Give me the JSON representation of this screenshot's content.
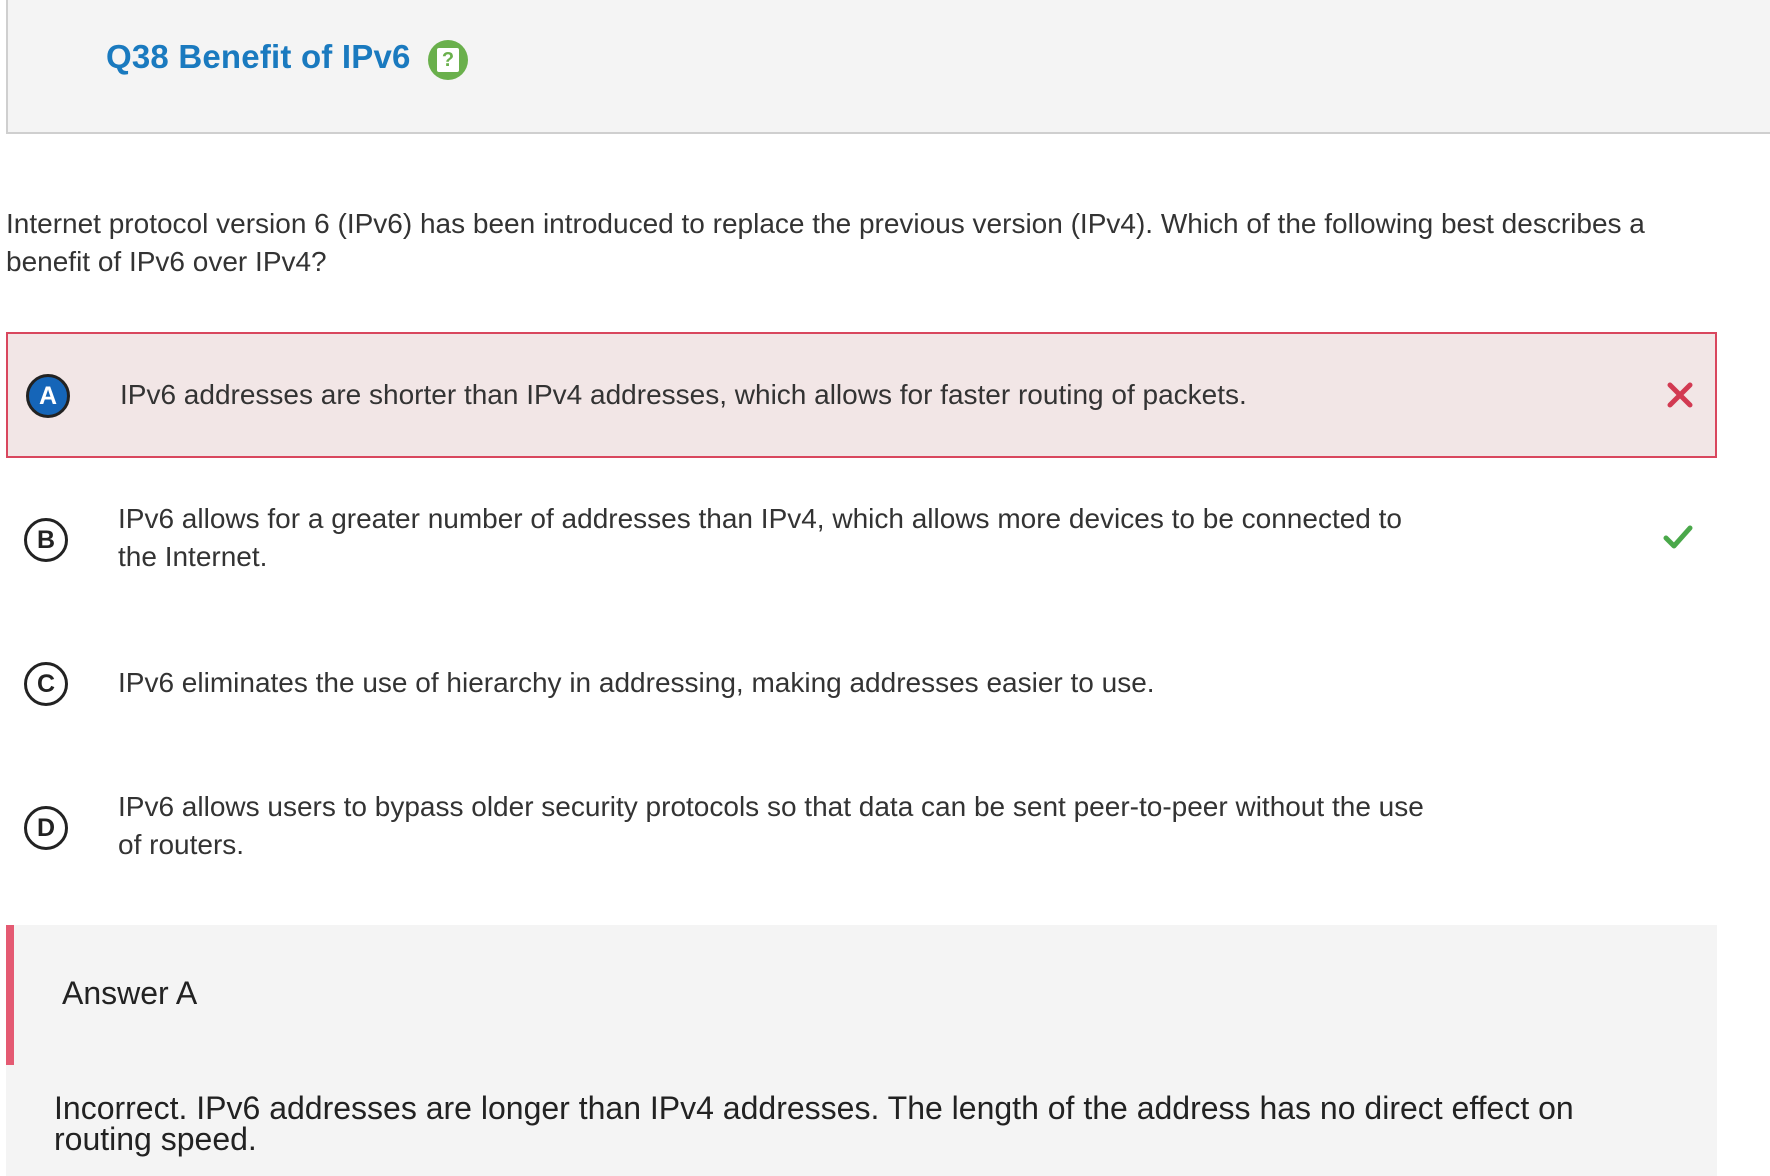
{
  "header": {
    "title": "Q38 Benefit of IPv6",
    "help_icon": "help-question-icon",
    "help_glyph": "?"
  },
  "question": {
    "text": "Internet protocol version 6 (IPv6) has been introduced to replace the previous version (IPv4). Which of the following best describes a benefit of IPv6 over IPv4?"
  },
  "options": [
    {
      "letter": "A",
      "text": "IPv6 addresses are shorter than IPv4 addresses, which allows for faster routing of packets.",
      "state": "selected-incorrect",
      "mark": "✕"
    },
    {
      "letter": "B",
      "text": "IPv6 allows for a greater number of addresses than IPv4, which allows more devices to be connected to the Internet.",
      "state": "correct",
      "mark": "✔"
    },
    {
      "letter": "C",
      "text": "IPv6 eliminates the use of hierarchy in addressing, making addresses easier to use.",
      "state": "none",
      "mark": ""
    },
    {
      "letter": "D",
      "text": "IPv6 allows users to bypass older security protocols so that data can be sent peer-to-peer without the use of routers.",
      "state": "none",
      "mark": ""
    }
  ],
  "feedback": {
    "answer_label": "Answer A",
    "explanation": "Incorrect. IPv6 addresses are longer than IPv4 addresses. The length of the address has no direct effect on routing speed."
  },
  "colors": {
    "title": "#1a7abf",
    "help_badge": "#6ab04c",
    "wrong_border": "#d9475e",
    "wrong_bg": "#f2e6e6",
    "chosen_letter_bg": "#1565b8",
    "wrong_mark": "#d23a52",
    "correct_mark": "#4aa84a",
    "feedback_bar": "#e45a72"
  }
}
